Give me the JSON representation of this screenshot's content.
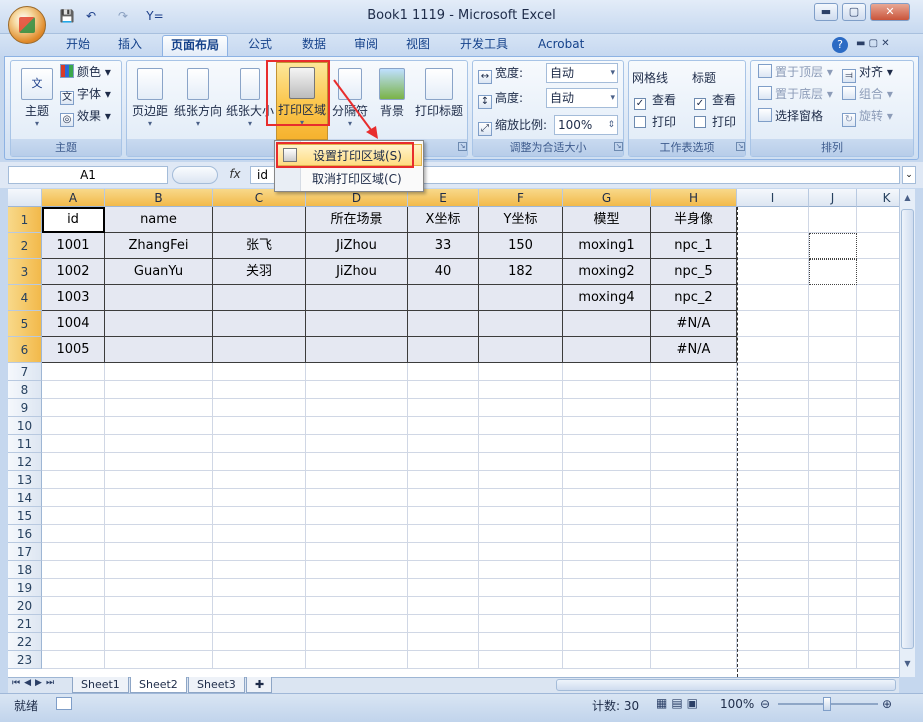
{
  "window": {
    "title": "Book1 1119 - Microsoft Excel",
    "minimize": "▬",
    "maximize": "▢",
    "close": "✕"
  },
  "qat": {
    "save": "💾",
    "undo": "↶",
    "redo": "↷",
    "custom": "Y="
  },
  "tabs": [
    "开始",
    "插入",
    "页面布局",
    "公式",
    "数据",
    "审阅",
    "视图",
    "开发工具",
    "Acrobat"
  ],
  "active_tab": "页面布局",
  "ribbon": {
    "theme": {
      "title": "主题",
      "themes_label": "主题",
      "colors": "颜色",
      "fonts": "字体",
      "effects": "效果"
    },
    "page_setup": {
      "title": "页面设置",
      "margins": "页边距",
      "orientation": "纸张方向",
      "size": "纸张大小",
      "print_area": "打印区域",
      "breaks": "分隔符",
      "background": "背景",
      "print_titles": "打印标题"
    },
    "scale": {
      "title": "调整为合适大小",
      "width_label": "宽度:",
      "width_value": "自动",
      "height_label": "高度:",
      "height_value": "自动",
      "scale_label": "缩放比例:",
      "scale_value": "100%"
    },
    "sheet_options": {
      "title": "工作表选项",
      "gridlines": "网格线",
      "headings": "标题",
      "view": "查看",
      "print": "打印"
    },
    "arrange": {
      "title": "排列",
      "bring_front": "置于顶层",
      "send_back": "置于底层",
      "selection_pane": "选择窗格",
      "align": "对齐",
      "group": "组合",
      "rotate": "旋转"
    }
  },
  "dropdown": {
    "set_print_area": "设置打印区域(S)",
    "clear_print_area": "取消打印区域(C)"
  },
  "formula_bar": {
    "name_box": "A1",
    "fx": "fx",
    "content": "id"
  },
  "columns": [
    "A",
    "B",
    "C",
    "D",
    "E",
    "F",
    "G",
    "H",
    "I",
    "J",
    "K"
  ],
  "rows": [
    "1",
    "2",
    "3",
    "4",
    "5",
    "6",
    "7",
    "8",
    "9",
    "10",
    "11",
    "12",
    "13",
    "14",
    "15",
    "16",
    "17",
    "18",
    "19",
    "20",
    "21",
    "22",
    "23"
  ],
  "table": [
    [
      "id",
      "name",
      "",
      "所在场景",
      "X坐标",
      "Y坐标",
      "模型",
      "半身像"
    ],
    [
      "1001",
      "ZhangFei",
      "张飞",
      "JiZhou",
      "33",
      "150",
      "moxing1",
      "npc_1"
    ],
    [
      "1002",
      "GuanYu",
      "关羽",
      "JiZhou",
      "40",
      "182",
      "moxing2",
      "npc_5"
    ],
    [
      "1003",
      "",
      "",
      "",
      "",
      "",
      "moxing4",
      "npc_2"
    ],
    [
      "1004",
      "",
      "",
      "",
      "",
      "",
      "",
      "#N/A"
    ],
    [
      "1005",
      "",
      "",
      "",
      "",
      "",
      "",
      "#N/A"
    ]
  ],
  "sheets": [
    "Sheet1",
    "Sheet2",
    "Sheet3"
  ],
  "active_sheet": "Sheet2",
  "status": {
    "ready": "就绪",
    "count": "计数: 30",
    "zoom": "100%"
  }
}
